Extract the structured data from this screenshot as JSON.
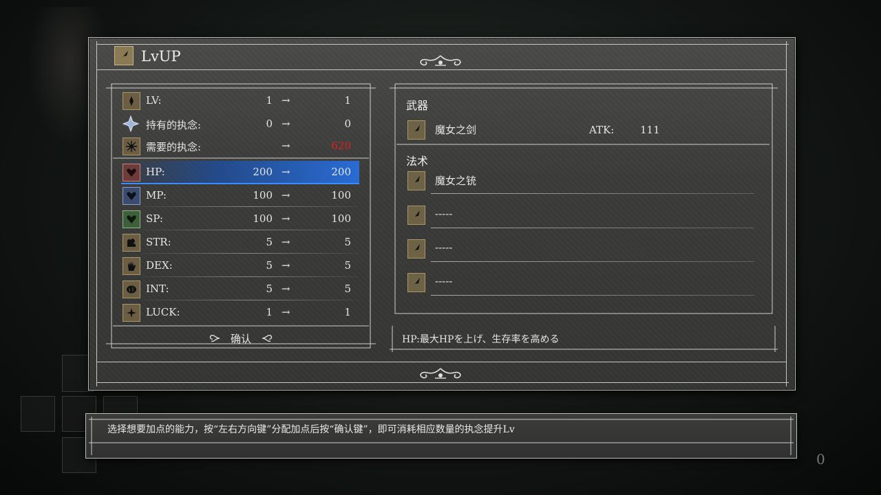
{
  "window": {
    "title": "LvUP"
  },
  "stats_top": [
    {
      "key": "lv",
      "label": "LV:",
      "from": "1",
      "arrow": "→",
      "to": "1",
      "icon": "level-icon"
    },
    {
      "key": "owned",
      "label": "持有的执念:",
      "from": "0",
      "arrow": "→",
      "to": "0",
      "icon": "crystal-icon"
    },
    {
      "key": "required",
      "label": "需要的执念:",
      "from": "",
      "arrow": "→",
      "to": "620",
      "icon": "required-icon",
      "to_color": "#e02020"
    }
  ],
  "stats": [
    {
      "key": "hp",
      "label": "HP:",
      "from": "200",
      "arrow": "→",
      "to": "200",
      "icon": "heart-icon",
      "selected": true
    },
    {
      "key": "mp",
      "label": "MP:",
      "from": "100",
      "arrow": "→",
      "to": "100",
      "icon": "mp-heart-icon"
    },
    {
      "key": "sp",
      "label": "SP:",
      "from": "100",
      "arrow": "→",
      "to": "100",
      "icon": "sp-heart-icon"
    },
    {
      "key": "str",
      "label": "STR:",
      "from": "5",
      "arrow": "→",
      "to": "5",
      "icon": "arm-icon"
    },
    {
      "key": "dex",
      "label": "DEX:",
      "from": "5",
      "arrow": "→",
      "to": "5",
      "icon": "hand-icon"
    },
    {
      "key": "int",
      "label": "INT:",
      "from": "5",
      "arrow": "→",
      "to": "5",
      "icon": "brain-icon"
    },
    {
      "key": "luck",
      "label": "LUCK:",
      "from": "1",
      "arrow": "→",
      "to": "1",
      "icon": "star-icon"
    }
  ],
  "confirm_label": "确认",
  "weapon": {
    "section": "武器",
    "name": "魔女之剑",
    "atk_label": "ATK:",
    "atk_value": "111",
    "icon": "weapon-icon"
  },
  "spells": {
    "section": "法术",
    "items": [
      {
        "name": "魔女之铳",
        "icon": "spell-icon"
      },
      {
        "name": "-----",
        "icon": "spell-icon"
      },
      {
        "name": "-----",
        "icon": "spell-icon"
      },
      {
        "name": "-----",
        "icon": "spell-icon"
      }
    ]
  },
  "description": "HP:最大HPを上げ、生存率を高める",
  "help_text": "选择想要加点的能力，按“左右方向键”分配加点后按“确认键”，即可消耗相应数量的执念提升Lv",
  "corner_counter": "0",
  "colors": {
    "accent_blue": "#2b6fd6",
    "warning_red": "#e02020"
  }
}
